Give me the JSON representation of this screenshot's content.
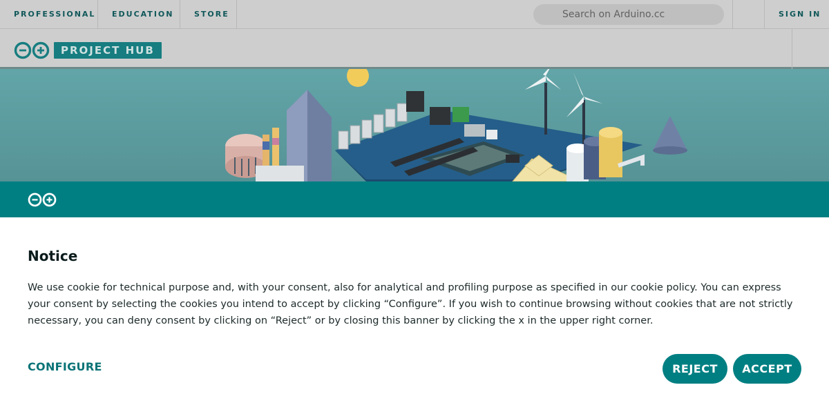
{
  "topbar": {
    "nav": [
      "PROFESSIONAL",
      "EDUCATION",
      "STORE"
    ],
    "search_placeholder": "Search on Arduino.cc",
    "sign_in": "SIGN IN"
  },
  "brand": {
    "badge": "PROJECT HUB"
  },
  "notice": {
    "title": "Notice",
    "body": "We use cookie for technical purpose and, with your consent, also for analytical and profiling purpose as specified in our cookie policy. You can express your consent by selecting the cookies you intend to accept by clicking “Configure”. If you wish to continue browsing without cookies that are not strictly necessary, you can deny consent by clicking on “Reject” or by closing this banner by clicking the x in the upper right corner.",
    "configure": "CONFIGURE",
    "reject": "REJECT",
    "accept": "ACCEPT"
  },
  "colors": {
    "teal": "#007f82",
    "nav_text": "#11585a",
    "overlay_gray": "#cecece"
  }
}
